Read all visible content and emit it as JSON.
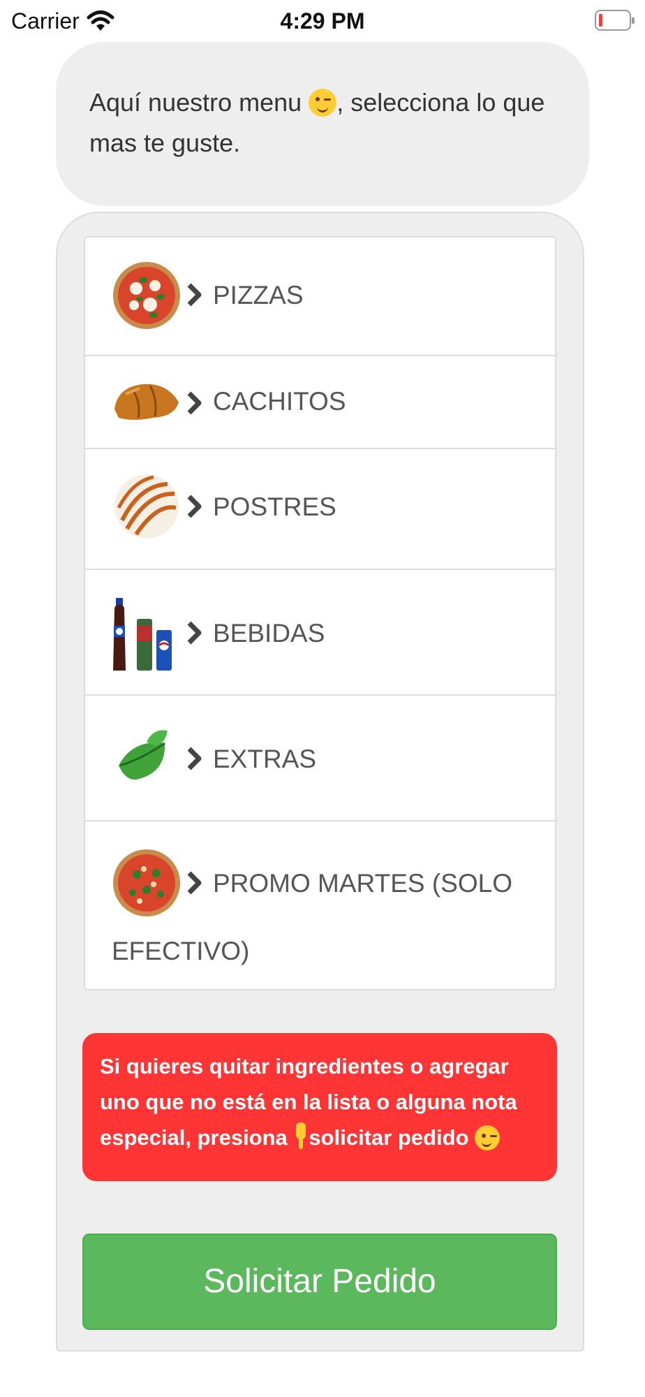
{
  "status_bar": {
    "carrier": "Carrier",
    "time": "4:29 PM"
  },
  "bubble": {
    "text_before": "Aquí nuestro menu",
    "text_after": ", selecciona lo que mas te guste."
  },
  "menu": {
    "items": [
      {
        "label": "PIZZAS",
        "image": "pizza-image"
      },
      {
        "label": "CACHITOS",
        "image": "cachito-image"
      },
      {
        "label": "POSTRES",
        "image": "dessert-image"
      },
      {
        "label": "BEBIDAS",
        "image": "drinks-image"
      },
      {
        "label": "EXTRAS",
        "image": "leaf-image"
      },
      {
        "label_line1": "PROMO MARTES (SOLO",
        "label_line2": "EFECTIVO)",
        "image": "pizza-promo-image"
      }
    ]
  },
  "notice": {
    "text_before": "Si quieres quitar ingredientes o agregar uno que no está en la lista o alguna nota especial, presiona ",
    "text_after": "solicitar pedido "
  },
  "order_button": {
    "label": "Solicitar Pedido"
  },
  "colors": {
    "notice_bg": "#ff3535",
    "button_bg": "#5cb85c"
  }
}
